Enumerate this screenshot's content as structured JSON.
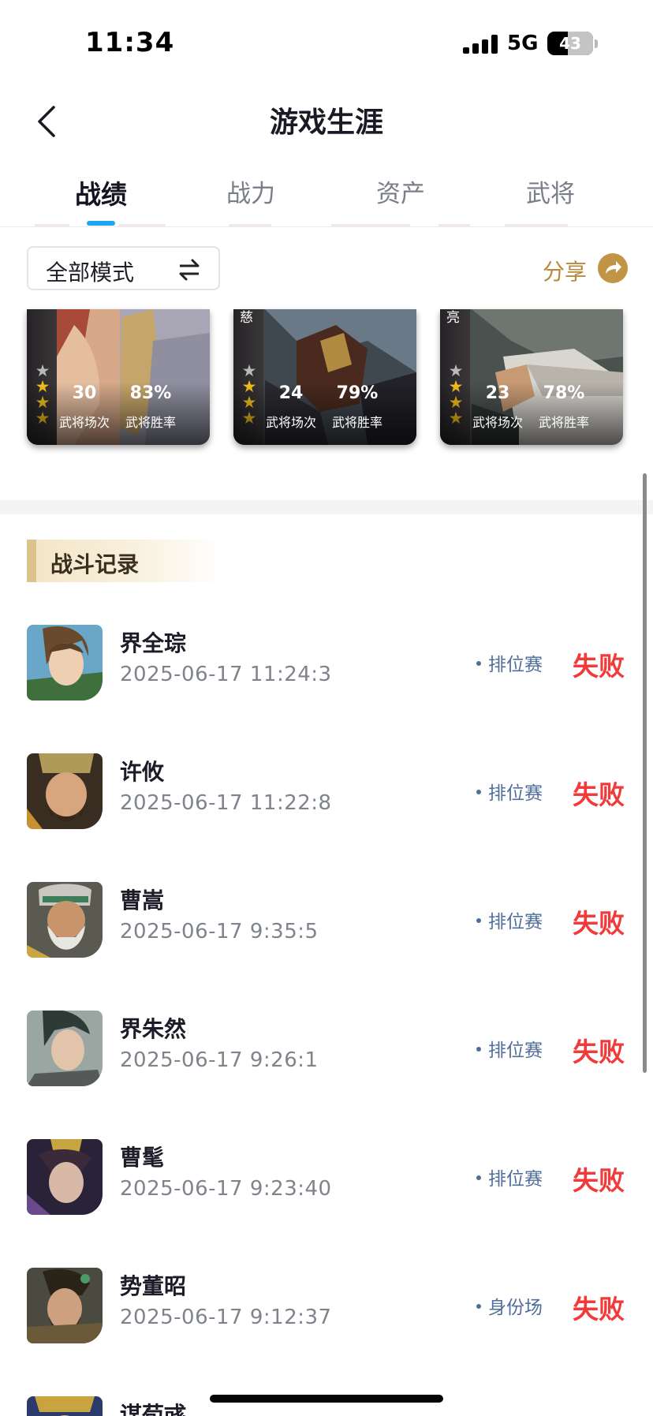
{
  "status_bar": {
    "time": "11:34",
    "network": "5G",
    "battery": "43"
  },
  "nav": {
    "title": "游戏生涯"
  },
  "tabs": [
    {
      "label": "战绩",
      "active": true
    },
    {
      "label": "战力",
      "active": false
    },
    {
      "label": "资产",
      "active": false
    },
    {
      "label": "武将",
      "active": false
    }
  ],
  "filter": {
    "mode_label": "全部模式",
    "share_label": "分享"
  },
  "hero_cards": [
    {
      "corner_text": "",
      "stars_total": 4,
      "stars_filled": 3,
      "matches": "30",
      "matches_label": "武将场次",
      "winrate": "83%",
      "winrate_label": "武将胜率"
    },
    {
      "corner_text": "慈",
      "stars_total": 4,
      "stars_filled": 3,
      "matches": "24",
      "matches_label": "武将场次",
      "winrate": "79%",
      "winrate_label": "武将胜率"
    },
    {
      "corner_text": "亮",
      "stars_total": 4,
      "stars_filled": 3,
      "matches": "23",
      "matches_label": "武将场次",
      "winrate": "78%",
      "winrate_label": "武将胜率"
    }
  ],
  "battle_records": {
    "title": "战斗记录",
    "items": [
      {
        "hero": "界全琮",
        "time": "2025-06-17 11:24:3",
        "mode": "排位赛",
        "result": "失败"
      },
      {
        "hero": "许攸",
        "time": "2025-06-17 11:22:8",
        "mode": "排位赛",
        "result": "失败"
      },
      {
        "hero": "曹嵩",
        "time": "2025-06-17 9:35:5",
        "mode": "排位赛",
        "result": "失败"
      },
      {
        "hero": "界朱然",
        "time": "2025-06-17 9:26:1",
        "mode": "排位赛",
        "result": "失败"
      },
      {
        "hero": "曹髦",
        "time": "2025-06-17 9:23:40",
        "mode": "排位赛",
        "result": "失败"
      },
      {
        "hero": "势董昭",
        "time": "2025-06-17 9:12:37",
        "mode": "身份场",
        "result": "失败"
      },
      {
        "hero": "谋荀彧",
        "time": "",
        "mode": "",
        "result": ""
      }
    ]
  },
  "colors": {
    "accent": "#1aa7ef",
    "loss": "#f23a3a",
    "mode": "#4f6e9a",
    "share": "#c19446"
  }
}
